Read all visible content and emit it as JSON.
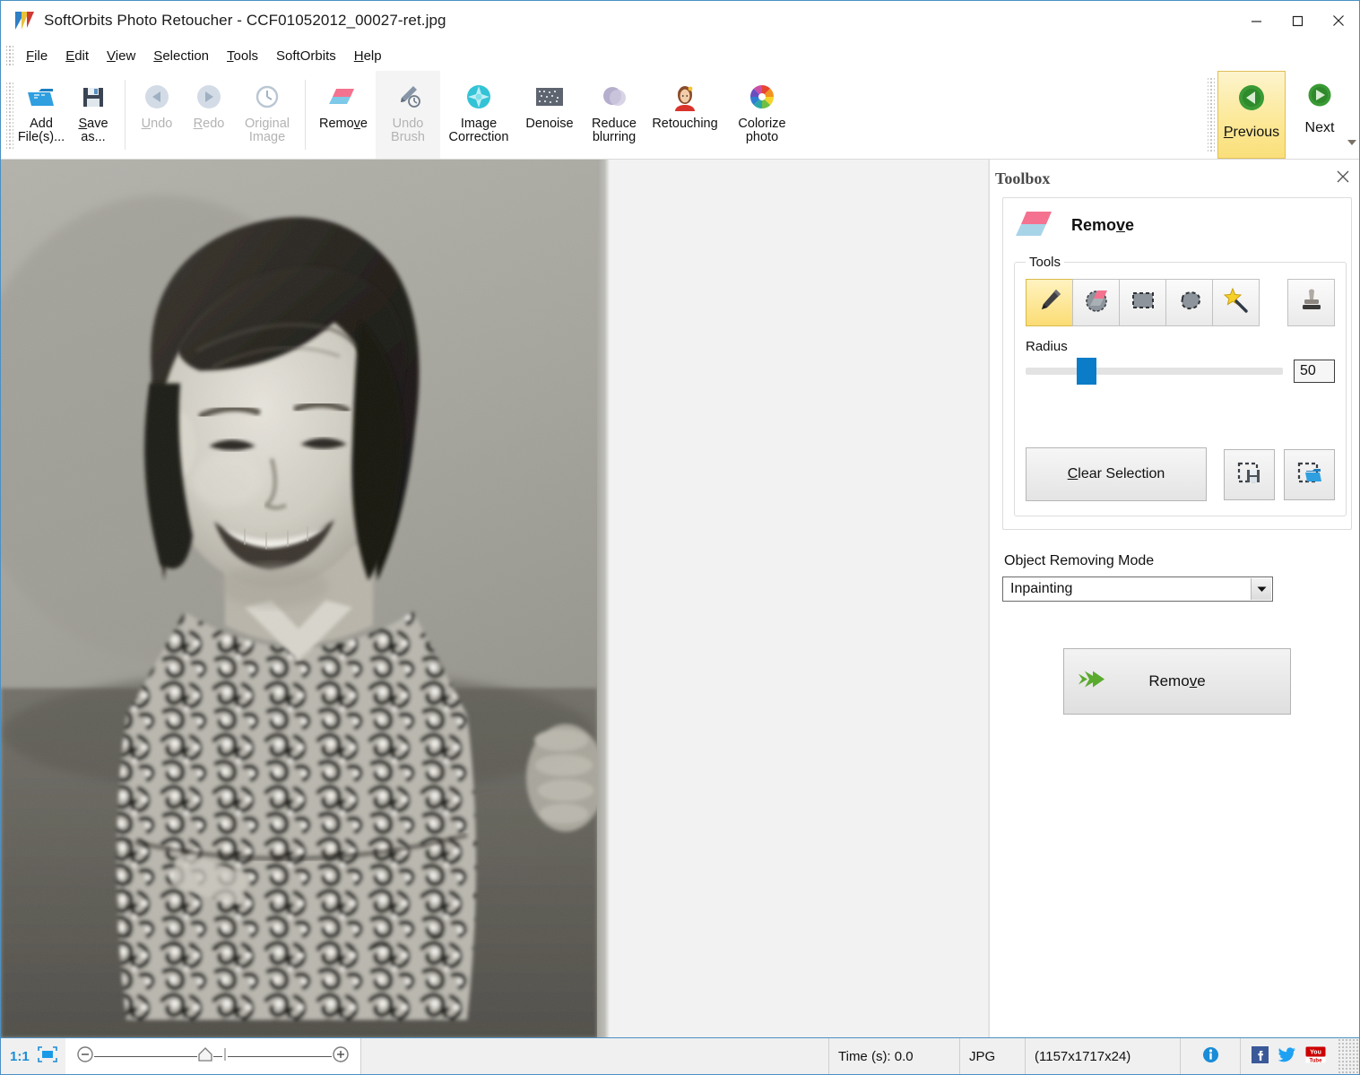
{
  "window": {
    "title": "SoftOrbits Photo Retoucher - CCF01052012_00027-ret.jpg",
    "minimize_label": "Minimize",
    "maximize_label": "Maximize",
    "close_label": "Close"
  },
  "menubar": {
    "items": [
      {
        "label": "File",
        "accel": "F"
      },
      {
        "label": "Edit",
        "accel": "E"
      },
      {
        "label": "View",
        "accel": "V"
      },
      {
        "label": "Selection",
        "accel": "S"
      },
      {
        "label": "Tools",
        "accel": "T"
      },
      {
        "label": "SoftOrbits",
        "accel": ""
      },
      {
        "label": "Help",
        "accel": "H"
      }
    ]
  },
  "toolbar": {
    "buttons": [
      {
        "id": "add-files",
        "line1": "Add",
        "line2": "File(s)...",
        "icon": "open-folder-icon",
        "disabled": false
      },
      {
        "id": "save-as",
        "line1": "Save",
        "line2": "as...",
        "icon": "floppy-disk-icon",
        "disabled": false
      },
      {
        "id": "undo",
        "line1": "Undo",
        "line2": "",
        "icon": "undo-arrow-icon",
        "disabled": true
      },
      {
        "id": "redo",
        "line1": "Redo",
        "line2": "",
        "icon": "redo-arrow-icon",
        "disabled": true
      },
      {
        "id": "original-image",
        "line1": "Original",
        "line2": "Image",
        "icon": "clock-history-icon",
        "disabled": true
      },
      {
        "id": "remove",
        "line1": "Remove",
        "line2": "",
        "icon": "eraser-icon",
        "disabled": false
      },
      {
        "id": "undo-brush",
        "line1": "Undo",
        "line2": "Brush",
        "icon": "brush-undo-icon",
        "disabled": true
      },
      {
        "id": "image-correction",
        "line1": "Image",
        "line2": "Correction",
        "icon": "sparkle-gem-icon",
        "disabled": false
      },
      {
        "id": "denoise",
        "line1": "Denoise",
        "line2": "",
        "icon": "noise-grid-icon",
        "disabled": false
      },
      {
        "id": "reduce-blurring",
        "line1": "Reduce",
        "line2": "blurring",
        "icon": "blur-circle-icon",
        "disabled": false
      },
      {
        "id": "retouching",
        "line1": "Retouching",
        "line2": "",
        "icon": "portrait-woman-icon",
        "disabled": false
      },
      {
        "id": "colorize-photo",
        "line1": "Colorize",
        "line2": "photo",
        "icon": "color-wheel-icon",
        "disabled": false
      }
    ],
    "previous_label": "Previous",
    "previous_accel": "P",
    "next_label": "Next",
    "overflow_label": "More toolbar commands"
  },
  "toolbox": {
    "panel_title": "Toolbox",
    "close_label": "Close toolbox",
    "section_title": "Remove",
    "section_accel": "v",
    "tools_legend": "Tools",
    "tools": [
      {
        "id": "brush",
        "icon": "pencil-brush-icon",
        "selected": true
      },
      {
        "id": "eraser",
        "icon": "eraser-tool-icon",
        "selected": false
      },
      {
        "id": "rectangle-select",
        "icon": "rectangle-select-icon",
        "selected": false
      },
      {
        "id": "lasso-select",
        "icon": "lasso-select-icon",
        "selected": false
      },
      {
        "id": "magic-wand",
        "icon": "magic-wand-icon",
        "selected": false
      }
    ],
    "stamp_tool": {
      "id": "stamp",
      "icon": "stamp-icon",
      "selected": false
    },
    "radius_label": "Radius",
    "radius_value": "50",
    "radius_percent": 20,
    "clear_selection_label": "Clear Selection",
    "clear_selection_accel": "C",
    "save_selection_label": "Save selection",
    "load_selection_label": "Load selection",
    "mode_label": "Object Removing Mode",
    "mode_value": "Inpainting",
    "mode_options": [
      "Inpainting"
    ],
    "remove_button_label": "Remove",
    "remove_button_accel": "v"
  },
  "statusbar": {
    "zoom_ratio": "1:1",
    "fit_label": "Fit to window",
    "zoom_out_label": "Zoom out",
    "zoom_in_label": "Zoom in",
    "time_label": "Time (s): 0.0",
    "format_label": "JPG",
    "dimensions_label": "(1157x1717x24)",
    "info_label": "Info",
    "facebook_label": "Facebook",
    "twitter_label": "Twitter",
    "youtube_label": "YouTube"
  },
  "colors": {
    "accent": "#1a8cd8",
    "highlight": "#fadf7a",
    "green": "#3a9a35",
    "canvas_bg": "#f2f2f2"
  }
}
